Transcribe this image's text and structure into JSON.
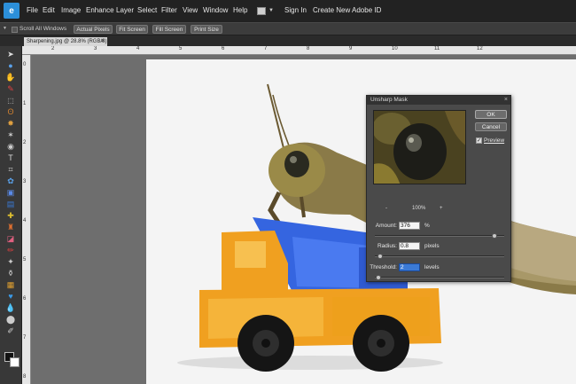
{
  "menu": {
    "logo": "e",
    "items": [
      "File",
      "Edit",
      "Image",
      "Enhance",
      "Layer",
      "Select",
      "Filter",
      "View",
      "Window",
      "Help"
    ],
    "sign_in": "Sign In",
    "create_id": "Create New Adobe ID"
  },
  "options": {
    "scroll_all_windows": "Scroll All Windows",
    "actual_pixels": "Actual Pixels",
    "fit_screen": "Fit Screen",
    "fill_screen": "Fill Screen",
    "print_size": "Print Size"
  },
  "document": {
    "tab_title": "Sharpening.jpg @ 28.8% (RGB/8)",
    "close": "×"
  },
  "rulers": {
    "top": [
      "2",
      "3",
      "4",
      "5",
      "6",
      "7",
      "8",
      "9",
      "10",
      "11",
      "12"
    ],
    "left": [
      "0",
      "1",
      "2",
      "3",
      "4",
      "5",
      "6",
      "7",
      "8"
    ]
  },
  "dialog": {
    "title": "Unsharp Mask",
    "close": "×",
    "ok": "OK",
    "cancel": "Cancel",
    "preview_checked": true,
    "preview_label": "Preview",
    "zoom_minus": "-",
    "zoom_value": "100%",
    "zoom_plus": "+",
    "amount": {
      "label": "Amount:",
      "value": "376",
      "unit": "%",
      "level": 0.94
    },
    "radius": {
      "label": "Radius:",
      "value": "0.8",
      "unit": "pixels",
      "level": 0.02
    },
    "threshold": {
      "label": "Threshold:",
      "value": "2",
      "unit": "levels",
      "level": 0.01
    }
  },
  "colors": {
    "truck_cab": "#f0a020",
    "truck_bed": "#3565e0",
    "accent_field": "#3b7ad6"
  }
}
